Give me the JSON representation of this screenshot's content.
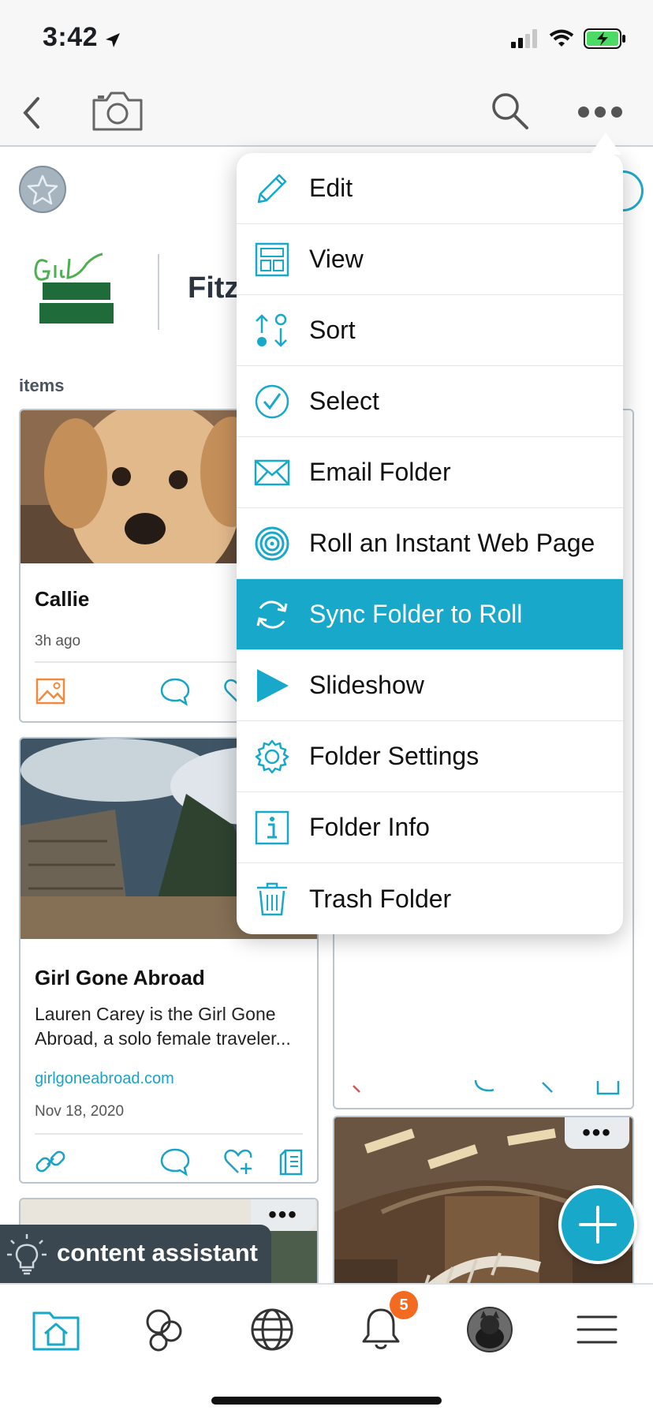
{
  "status_bar": {
    "time": "3:42"
  },
  "folder": {
    "title": "Fitz",
    "items_label": "items"
  },
  "cards": {
    "callie": {
      "title": "Callie",
      "time": "3h ago"
    },
    "ggabroad": {
      "title": "Girl Gone Abroad",
      "description": "Lauren Carey is the Girl Gone Abroad, a solo female traveler...",
      "link": "girlgoneabroad.com",
      "date": "Nov 18, 2020"
    }
  },
  "menu": {
    "items": [
      {
        "label": "Edit",
        "icon": "pencil-icon"
      },
      {
        "label": "View",
        "icon": "layout-icon"
      },
      {
        "label": "Sort",
        "icon": "sort-icon"
      },
      {
        "label": "Select",
        "icon": "check-circle-icon"
      },
      {
        "label": "Email Folder",
        "icon": "envelope-icon"
      },
      {
        "label": "Roll an Instant Web Page",
        "icon": "spiral-icon"
      },
      {
        "label": "Sync Folder to Roll",
        "icon": "sync-icon",
        "active": true
      },
      {
        "label": "Slideshow",
        "icon": "play-icon"
      },
      {
        "label": "Folder Settings",
        "icon": "gear-icon"
      },
      {
        "label": "Folder Info",
        "icon": "info-icon"
      },
      {
        "label": "Trash Folder",
        "icon": "trash-icon"
      }
    ]
  },
  "assistant": {
    "label": "content assistant"
  },
  "tab_bar": {
    "notifications_badge": "5"
  },
  "colors": {
    "accent": "#18a8ca",
    "badge": "#f26b21",
    "assistant_bg": "#3a4750"
  }
}
